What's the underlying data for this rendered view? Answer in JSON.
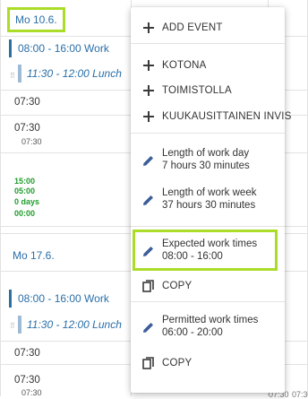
{
  "days": [
    {
      "header": "Mo 10.6.",
      "work_event": "08:00 - 16:00 Work",
      "lunch_event": "11:30 - 12:00 Lunch",
      "time1": "07:30",
      "time2": "07:30",
      "time2_small": "07:30",
      "summary": [
        "15:00",
        "05:00",
        "0 days",
        "00:00"
      ]
    },
    {
      "header": "Mo 17.6.",
      "work_event": "08:00 - 16:00 Work",
      "lunch_event": "11:30 - 12:00 Lunch",
      "time1": "07:30",
      "time2": "07:30",
      "time2_small": "07:30"
    }
  ],
  "background_times": [
    "07:30",
    "07:30"
  ],
  "menu": {
    "add_event": "ADD EVENT",
    "templates": [
      "KOTONA",
      "TOIMISTOLLA",
      "KUUKAUSITTAINEN INVIS"
    ],
    "work_day_label": "Length of work day",
    "work_day_value": "7 hours 30 minutes",
    "work_week_label": "Length of work week",
    "work_week_value": "37 hours 30 minutes",
    "expected_label": "Expected work times",
    "expected_value": "08:00 - 16:00",
    "copy_label": "COPY",
    "permitted_label": "Permitted work times",
    "permitted_value": "06:00 - 20:00",
    "copy_label_2": "COPY"
  },
  "colors": {
    "highlight": "#aadc28",
    "link": "#2a6fa8",
    "green": "#1f9d2c",
    "event_bar": "#2b6fa3"
  },
  "icons": [
    "plus-icon",
    "pencil-icon",
    "copy-icon"
  ]
}
